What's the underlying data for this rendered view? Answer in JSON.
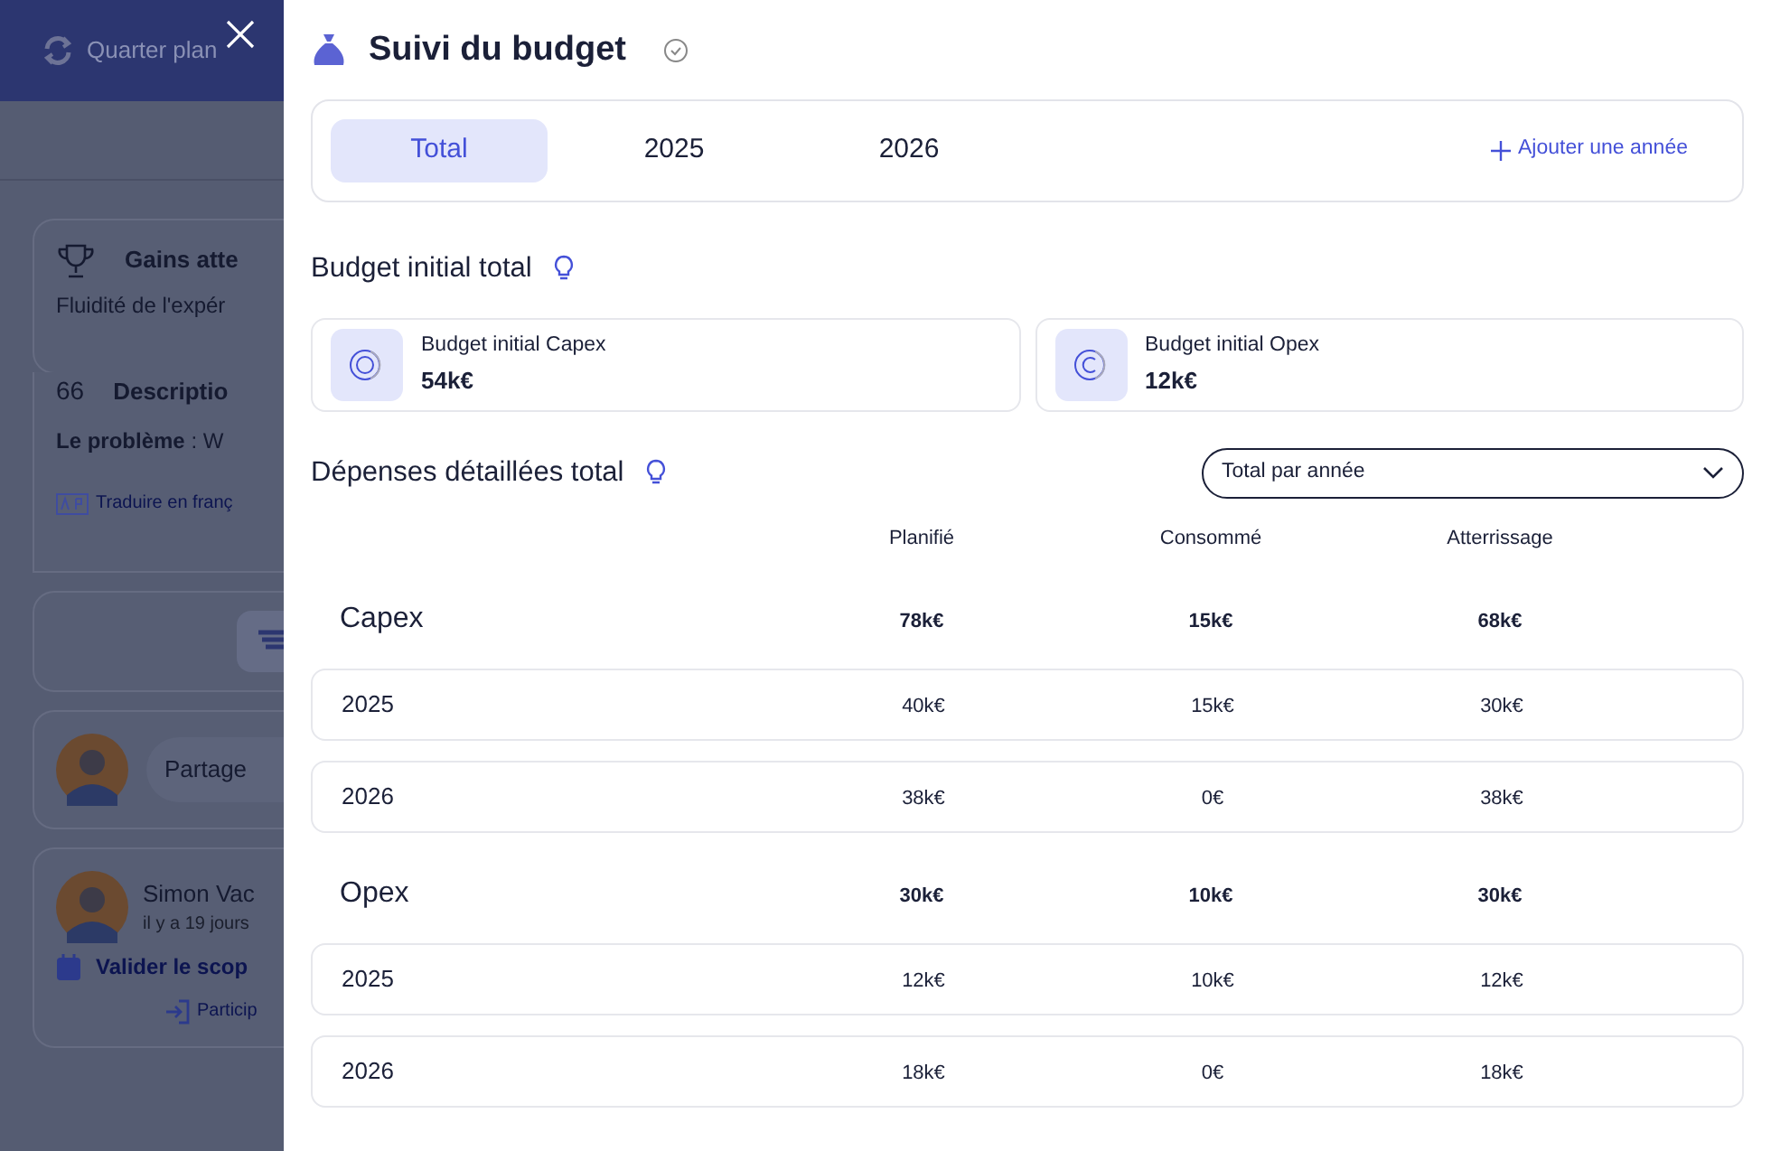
{
  "background": {
    "header": {
      "title": "Quarter plan"
    },
    "cards": [
      {
        "kind": "gains",
        "heading": "Gains atte",
        "text": "Fluidité de l'expér"
      },
      {
        "kind": "description",
        "quote_mark": "66",
        "heading": "Descriptio",
        "text": "**Le problème** : W",
        "link": "Traduire en franç"
      },
      {
        "kind": "filter"
      },
      {
        "kind": "share",
        "text": "Partage"
      },
      {
        "kind": "comment",
        "author": "Simon Vac",
        "time": "il y a 19 jours",
        "task": "Valider le scop",
        "link": "Particip"
      }
    ]
  },
  "panel": {
    "title": "Suivi du budget",
    "verified": true,
    "tabs": [
      {
        "label": "Total",
        "selected": true
      },
      {
        "label": "2025",
        "selected": false
      },
      {
        "label": "2026",
        "selected": false
      }
    ],
    "add_year": "Ajouter une année",
    "initial": {
      "title": "Budget initial total",
      "items": [
        {
          "kind": "capex",
          "label": "Budget initial Capex",
          "value": "54k€"
        },
        {
          "kind": "opex",
          "label": "Budget initial Opex",
          "value": "12k€"
        }
      ]
    },
    "details": {
      "title": "Dépenses détaillées total",
      "select": "Total par année",
      "columns": [
        "Planifié",
        "Consommé",
        "Atterrissage"
      ],
      "rows": [
        {
          "kind": "group",
          "name": "Capex",
          "values": [
            "78k€",
            "15k€",
            "68k€"
          ]
        },
        {
          "kind": "year",
          "name": "2025",
          "values": [
            "40k€",
            "15k€",
            "30k€"
          ]
        },
        {
          "kind": "year",
          "name": "2026",
          "values": [
            "38k€",
            "0€",
            "38k€"
          ]
        },
        {
          "kind": "group",
          "name": "Opex",
          "values": [
            "30k€",
            "10k€",
            "30k€"
          ]
        },
        {
          "kind": "year",
          "name": "2025",
          "values": [
            "12k€",
            "10k€",
            "12k€"
          ]
        },
        {
          "kind": "year",
          "name": "2026",
          "values": [
            "18k€",
            "0€",
            "18k€"
          ]
        }
      ]
    }
  }
}
